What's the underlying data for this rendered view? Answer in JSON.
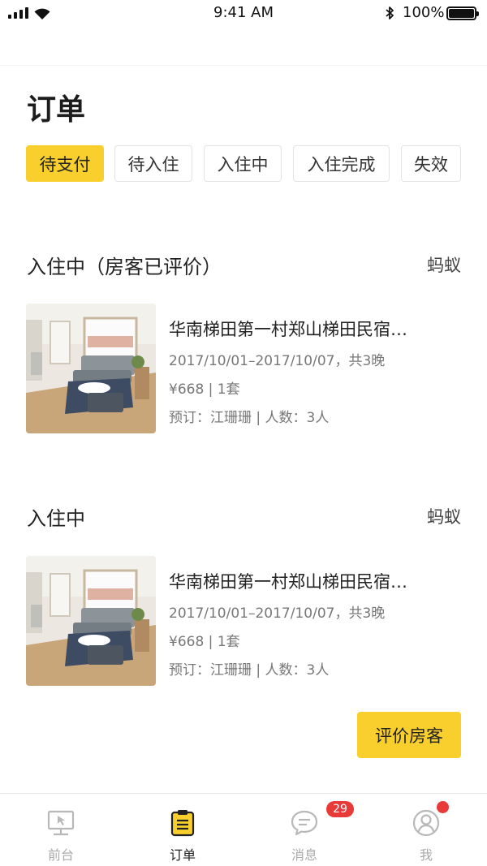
{
  "status_bar": {
    "time": "9:41 AM",
    "battery": "100%",
    "battery_level": 1.0
  },
  "header": {
    "title": "订单"
  },
  "tabs": [
    {
      "label": "待支付",
      "active": true
    },
    {
      "label": "待入住",
      "active": false
    },
    {
      "label": "入住中",
      "active": false
    },
    {
      "label": "入住完成",
      "active": false
    },
    {
      "label": "失效",
      "active": false
    }
  ],
  "orders": [
    {
      "status": "入住中（房客已评价）",
      "host": "蚂蚁",
      "property": "华南梯田第一村郑山梯田民宿…",
      "dates": "2017/10/01–2017/10/07，共3晚",
      "price": "¥668 | 1套",
      "booker": "预订：江珊珊 | 人数：3人"
    },
    {
      "status": "入住中",
      "host": "蚂蚁",
      "property": "华南梯田第一村郑山梯田民宿…",
      "dates": "2017/10/01–2017/10/07，共3晚",
      "price": "¥668 | 1套",
      "booker": "预订：江珊珊 | 人数：3人",
      "action": "评价房客"
    }
  ],
  "tab_bar": {
    "items": [
      {
        "label": "前台",
        "icon": "monitor-icon"
      },
      {
        "label": "订单",
        "icon": "clipboard-icon",
        "active": true
      },
      {
        "label": "消息",
        "icon": "chat-bubble-icon",
        "badge": "29"
      },
      {
        "label": "我",
        "icon": "user-icon",
        "dot": true
      }
    ]
  },
  "colors": {
    "accent": "#f8cf2c",
    "badge": "#e93a3a"
  }
}
